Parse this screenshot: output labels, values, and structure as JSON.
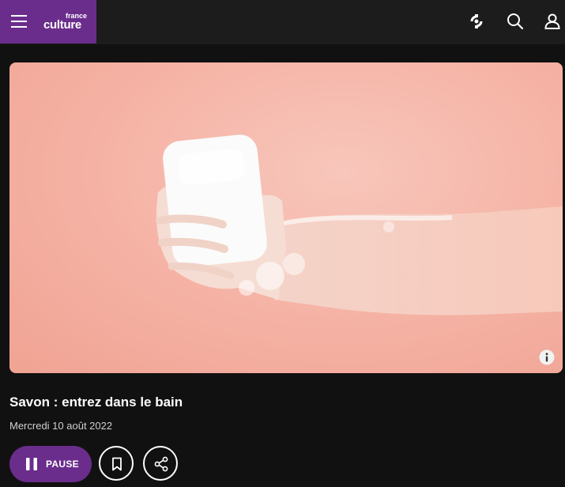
{
  "brand": {
    "logo_small": "france",
    "logo_big": "culture",
    "color": "#6b2d8c"
  },
  "header": {
    "icons": [
      "menu-icon",
      "radio-live-icon",
      "search-icon",
      "user-icon"
    ]
  },
  "episode": {
    "title": "Savon : entrez dans le bain",
    "date": "Mercredi 10 août 2022"
  },
  "actions": {
    "pause_label": "PAUSE",
    "icons": [
      "pause-icon",
      "bookmark-icon",
      "share-icon"
    ]
  },
  "colors": {
    "background": "#111111",
    "topbar": "#1c1c1c",
    "accent": "#6b2d8c",
    "hero_bg": "#f5b3a5"
  }
}
